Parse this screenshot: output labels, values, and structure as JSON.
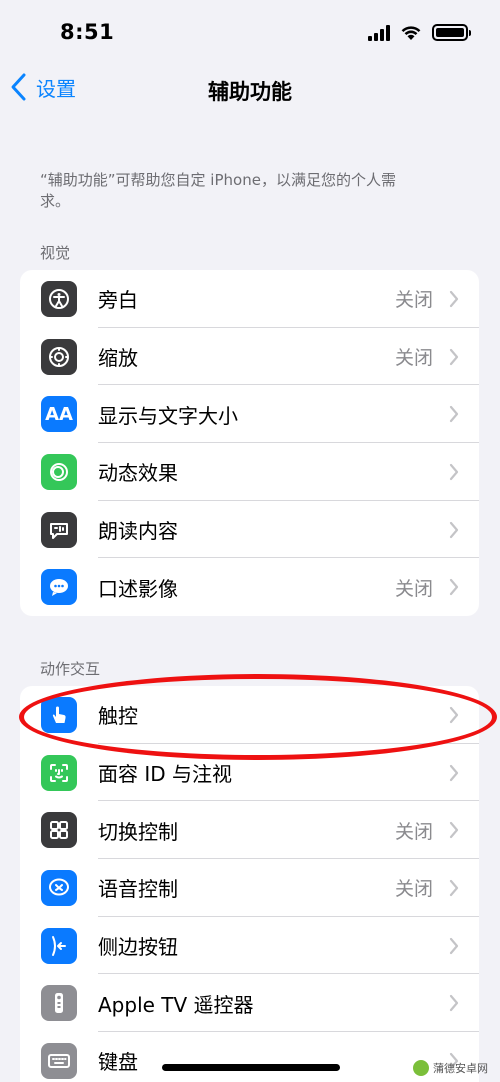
{
  "status_bar": {
    "time": "8:51",
    "battery_level": 1.0
  },
  "nav": {
    "back_label": "设置",
    "title": "辅助功能"
  },
  "description": "“辅助功能”可帮助您自定 iPhone，以满足您的个人需求。",
  "sections": {
    "vision": {
      "header": "视觉",
      "items": [
        {
          "label": "旁白",
          "value": "关闭",
          "icon": "voiceover-icon",
          "color": "#3a3a3c"
        },
        {
          "label": "缩放",
          "value": "关闭",
          "icon": "zoom-icon",
          "color": "#3a3a3c"
        },
        {
          "label": "显示与文字大小",
          "value": "",
          "icon": "text-size-icon",
          "color": "#0a7aff",
          "glyph": "AA"
        },
        {
          "label": "动态效果",
          "value": "",
          "icon": "motion-icon",
          "color": "#34c759"
        },
        {
          "label": "朗读内容",
          "value": "",
          "icon": "spoken-content-icon",
          "color": "#3a3a3c"
        },
        {
          "label": "口述影像",
          "value": "关闭",
          "icon": "audio-description-icon",
          "color": "#0a7aff"
        }
      ]
    },
    "interaction": {
      "header": "动作交互",
      "items": [
        {
          "label": "触控",
          "value": "",
          "icon": "touch-icon",
          "color": "#0a7aff"
        },
        {
          "label": "面容 ID 与注视",
          "value": "",
          "icon": "face-id-icon",
          "color": "#34c759"
        },
        {
          "label": "切换控制",
          "value": "关闭",
          "icon": "switch-control-icon",
          "color": "#3a3a3c"
        },
        {
          "label": "语音控制",
          "value": "关闭",
          "icon": "voice-control-icon",
          "color": "#0a7aff"
        },
        {
          "label": "侧边按钮",
          "value": "",
          "icon": "side-button-icon",
          "color": "#0a7aff"
        },
        {
          "label": "Apple TV 遥控器",
          "value": "",
          "icon": "apple-tv-remote-icon",
          "color": "#8e8e93"
        },
        {
          "label": "键盘",
          "value": "",
          "icon": "keyboard-icon",
          "color": "#8e8e93"
        }
      ]
    }
  },
  "watermark": "蒲德安卓网"
}
